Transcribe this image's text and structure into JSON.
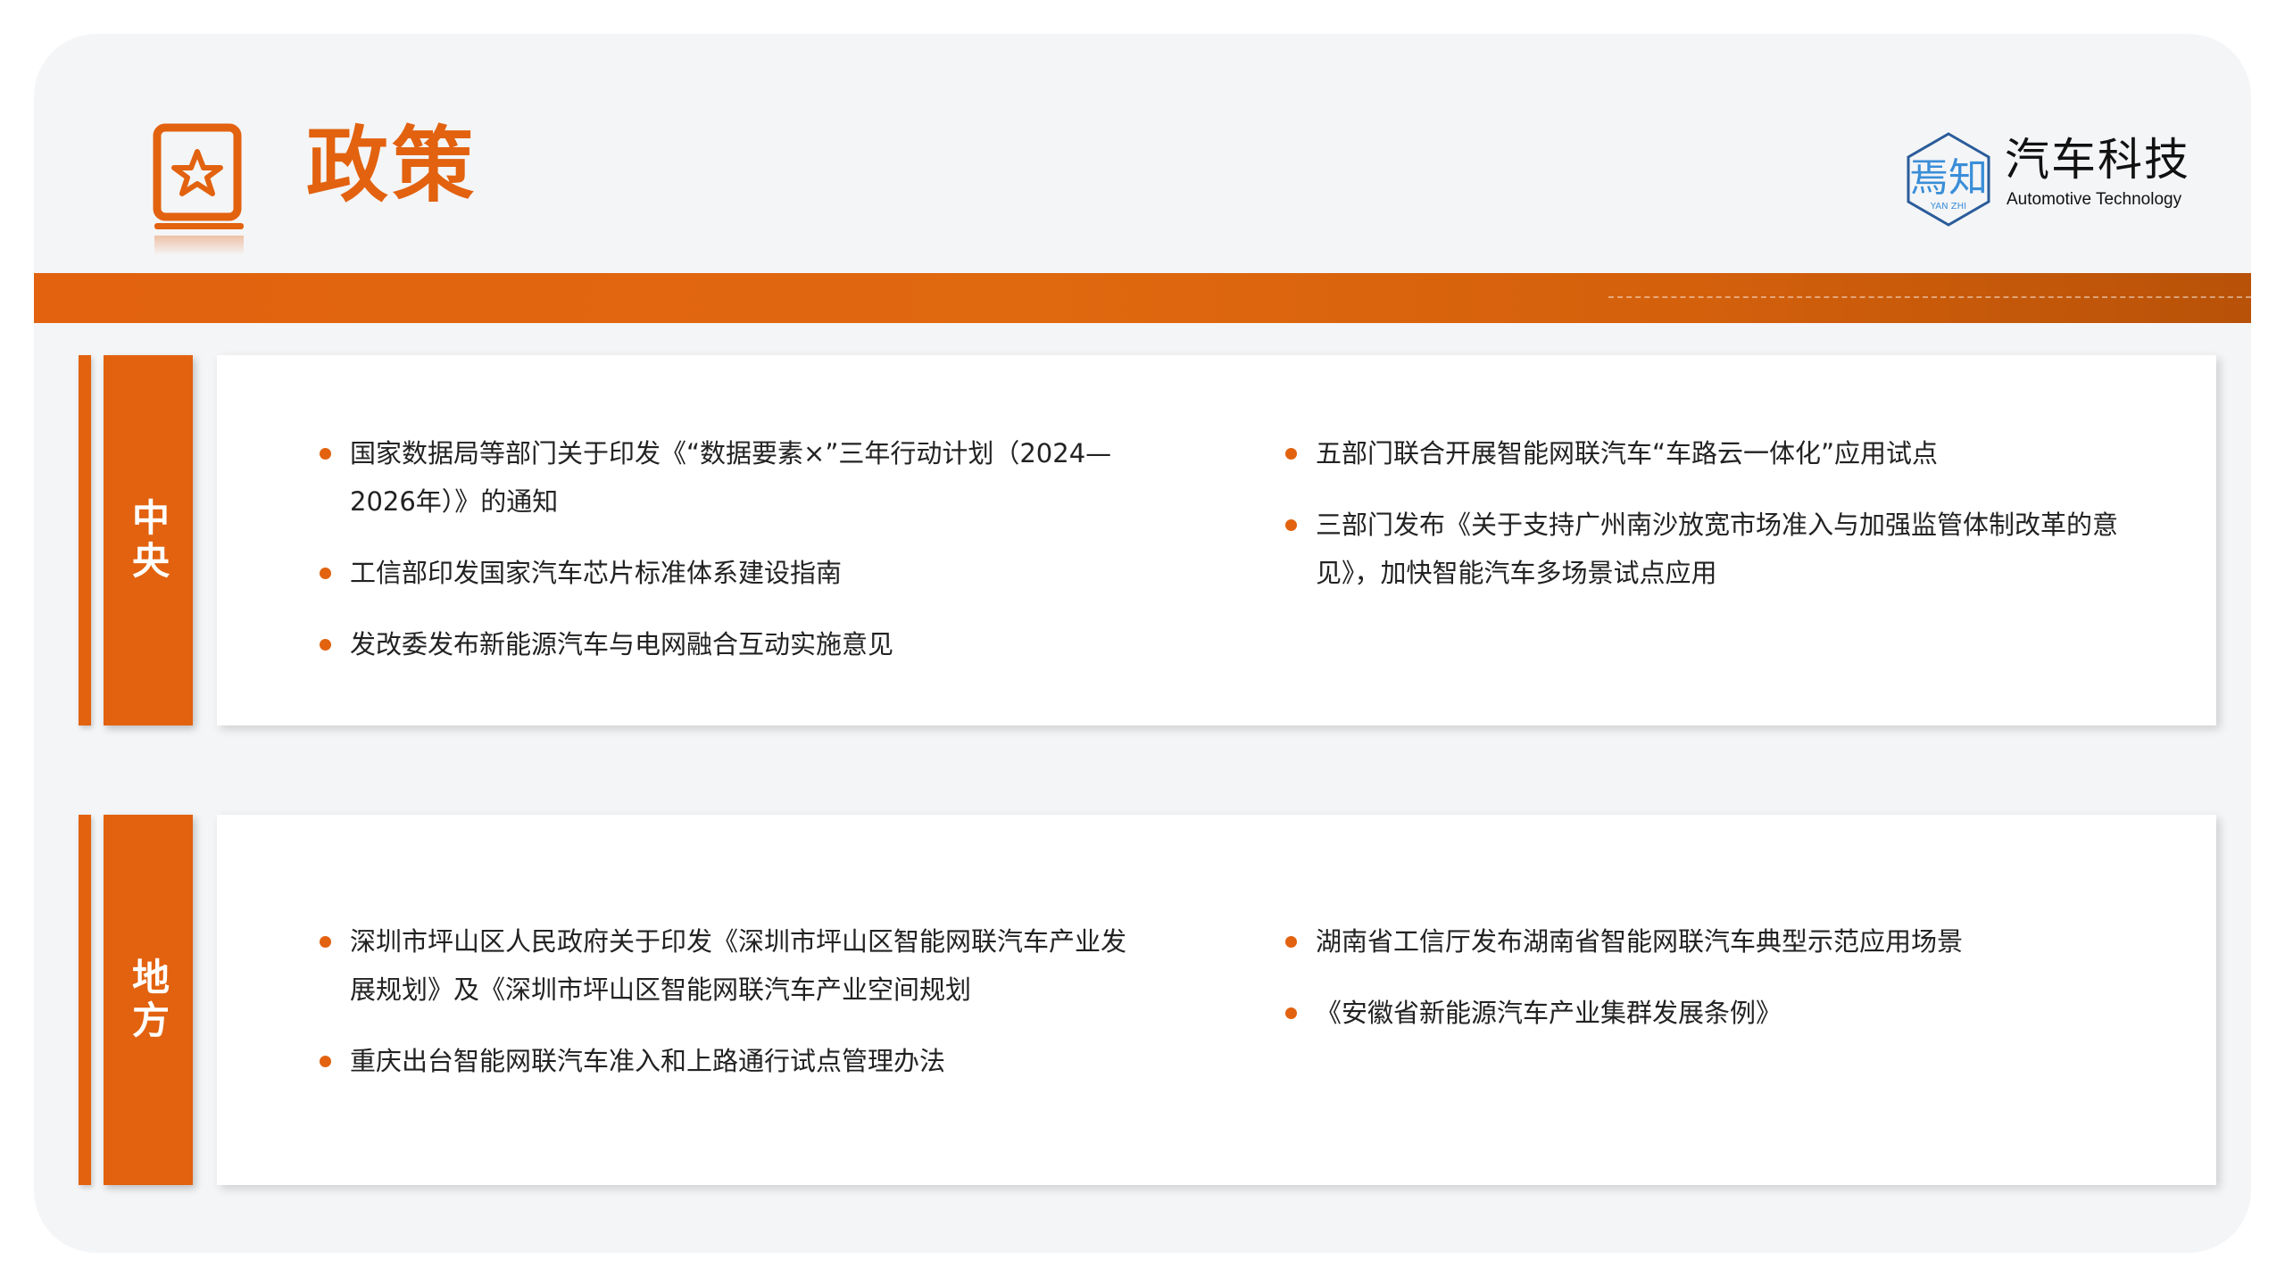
{
  "page": {
    "title": "政策",
    "accent_color": "#e2620f",
    "title_icon": "star-badge-icon"
  },
  "logo": {
    "mark_text": "焉知",
    "mark_sub": "YAN ZHI",
    "name_cn": "汽车科技",
    "name_en": "Automotive Technology"
  },
  "sections": {
    "central": {
      "label": "中央",
      "left": [
        "国家数据局等部门关于印发《“数据要素×”三年行动计划（2024—2026年）》的通知",
        "工信部印发国家汽车芯片标准体系建设指南",
        "发改委发布新能源汽车与电网融合互动实施意见"
      ],
      "right": [
        "五部门联合开展智能网联汽车“车路云一体化”应用试点",
        "三部门发布《关于支持广州南沙放宽市场准入与加强监管体制改革的意见》，加快智能汽车多场景试点应用"
      ]
    },
    "local": {
      "label": "地方",
      "left": [
        "深圳市坪山区人民政府关于印发《深圳市坪山区智能网联汽车产业发展规划》及《深圳市坪山区智能网联汽车产业空间规划",
        "重庆出台智能网联汽车准入和上路通行试点管理办法"
      ],
      "right": [
        "湖南省工信厅发布湖南省智能网联汽车典型示范应用场景",
        "《安徽省新能源汽车产业集群发展条例》"
      ]
    }
  }
}
